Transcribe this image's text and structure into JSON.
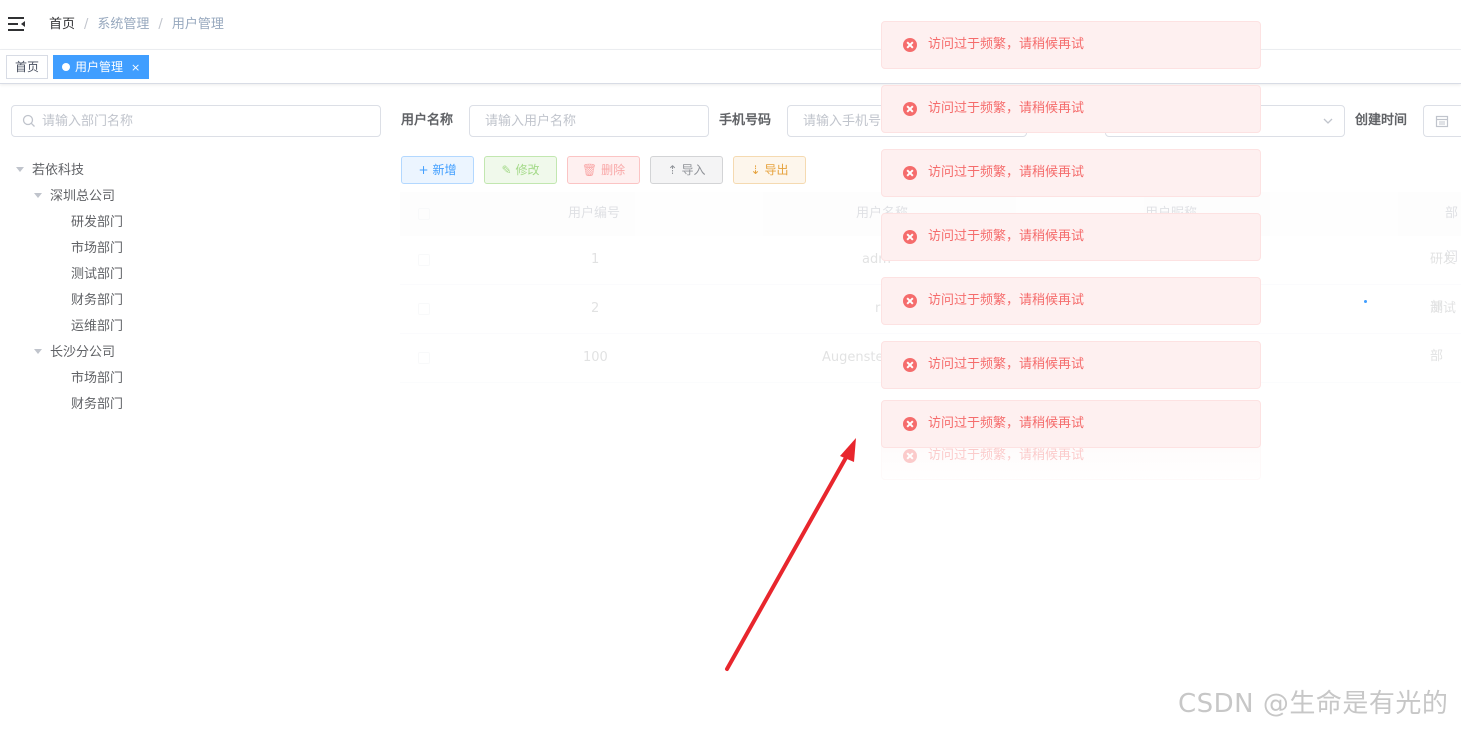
{
  "navbar": {
    "breadcrumbs": [
      "首页",
      "系统管理",
      "用户管理"
    ],
    "separator": "/"
  },
  "tags": {
    "home": "首页",
    "active": "用户管理",
    "close": "×"
  },
  "dept": {
    "search_placeholder": "请输入部门名称",
    "tree": {
      "root": "若依科技",
      "shenzhen": "深圳总公司",
      "sz_children": [
        "研发部门",
        "市场部门",
        "测试部门",
        "财务部门",
        "运维部门"
      ],
      "changsha": "长沙分公司",
      "cs_children": [
        "市场部门",
        "财务部门"
      ]
    }
  },
  "filters": {
    "username_label": "用户名称",
    "username_placeholder": "请输入用户名称",
    "phone_label": "手机号码",
    "phone_placeholder": "请输入手机号码",
    "created_label": "创建时间"
  },
  "toolbar": {
    "add": "新增",
    "edit": "修改",
    "delete": "删除",
    "import": "导入",
    "export": "导出"
  },
  "table": {
    "headers": [
      "用户编号",
      "用户名称",
      "用户昵称",
      "部门"
    ],
    "rows": [
      {
        "id": "1",
        "name": "adm",
        "dept": "研发部"
      },
      {
        "id": "2",
        "name": "r",
        "dept": "测试部"
      },
      {
        "id": "100",
        "name": "Augenste",
        "dept": ""
      }
    ]
  },
  "messages": {
    "error_text": "访问过于频繁，请稍候再试",
    "count": 8
  },
  "colors": {
    "primary": "#409eff",
    "danger": "#f56c6c",
    "arrow": "#e8262d"
  },
  "watermark": "CSDN @生命是有光的"
}
